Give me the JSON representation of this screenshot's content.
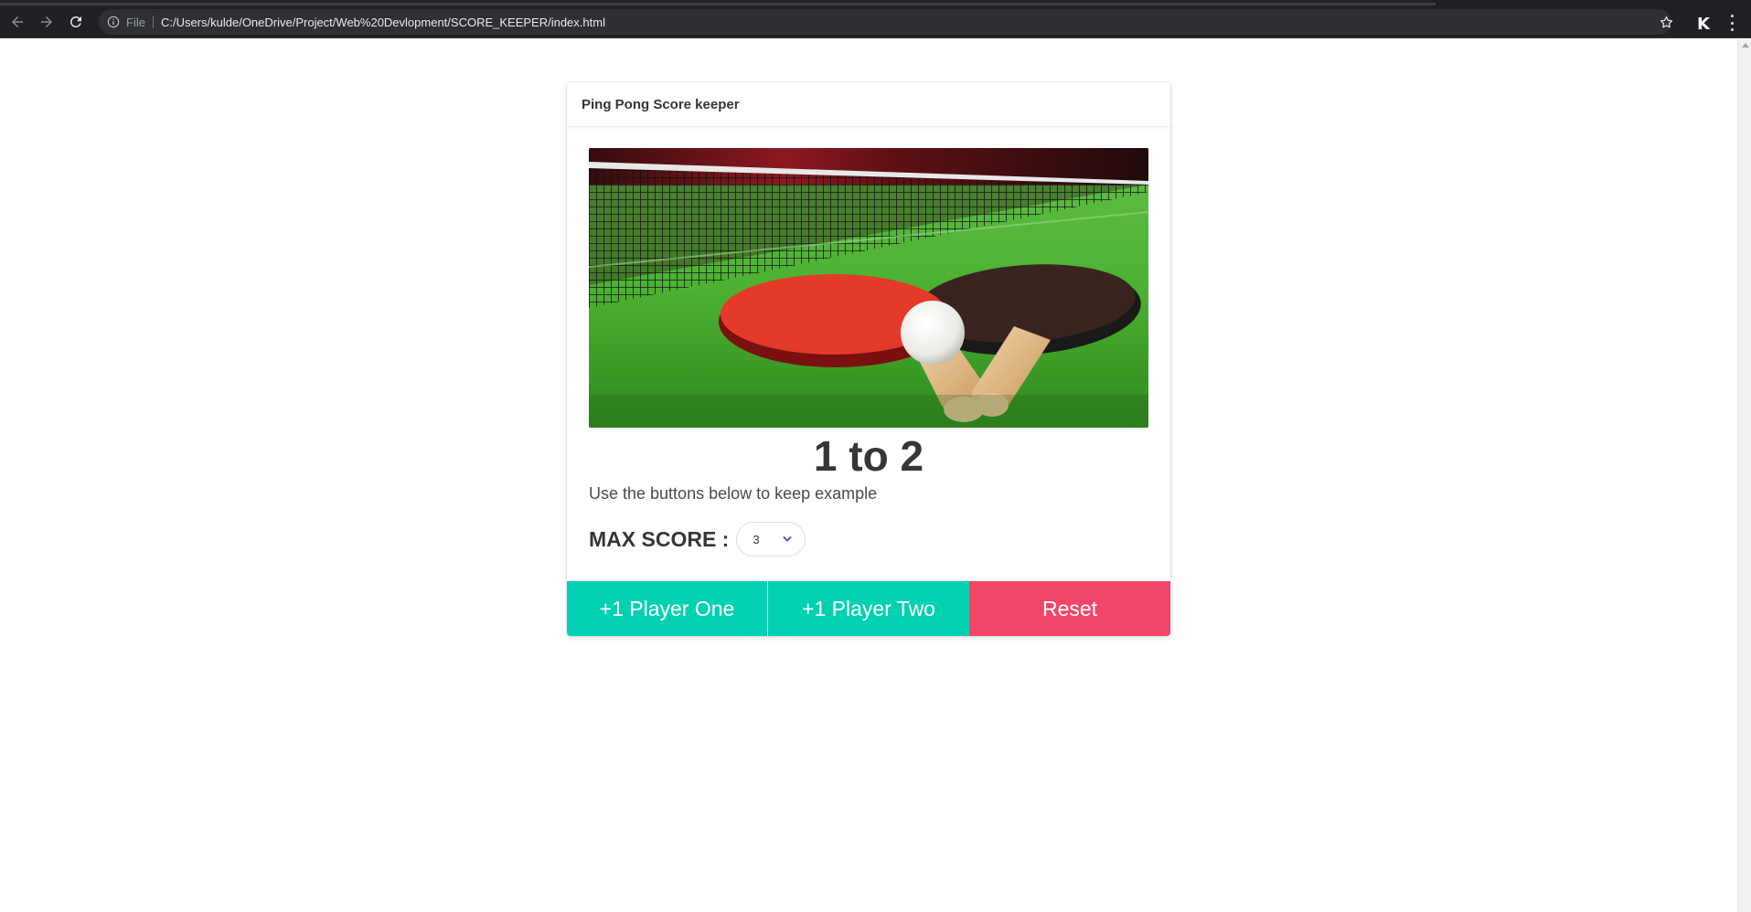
{
  "browser": {
    "file_label": "File",
    "url": "C:/Users/kulde/OneDrive/Project/Web%20Devlopment/SCORE_KEEPER/index.html",
    "extension_letter": "K"
  },
  "card": {
    "header_title": "Ping Pong Score keeper",
    "image_alt": "ping-pong-paddles-photo",
    "score_text": "1 to 2",
    "subtitle": "Use the buttons below to keep example",
    "max_score_label": "MAX SCORE :",
    "max_score_value": "3"
  },
  "buttons": {
    "player_one": "+1 Player One",
    "player_two": "+1 Player Two",
    "reset": "Reset"
  },
  "colors": {
    "primary": "#00d1b2",
    "danger": "#f14668",
    "text": "#363636"
  }
}
